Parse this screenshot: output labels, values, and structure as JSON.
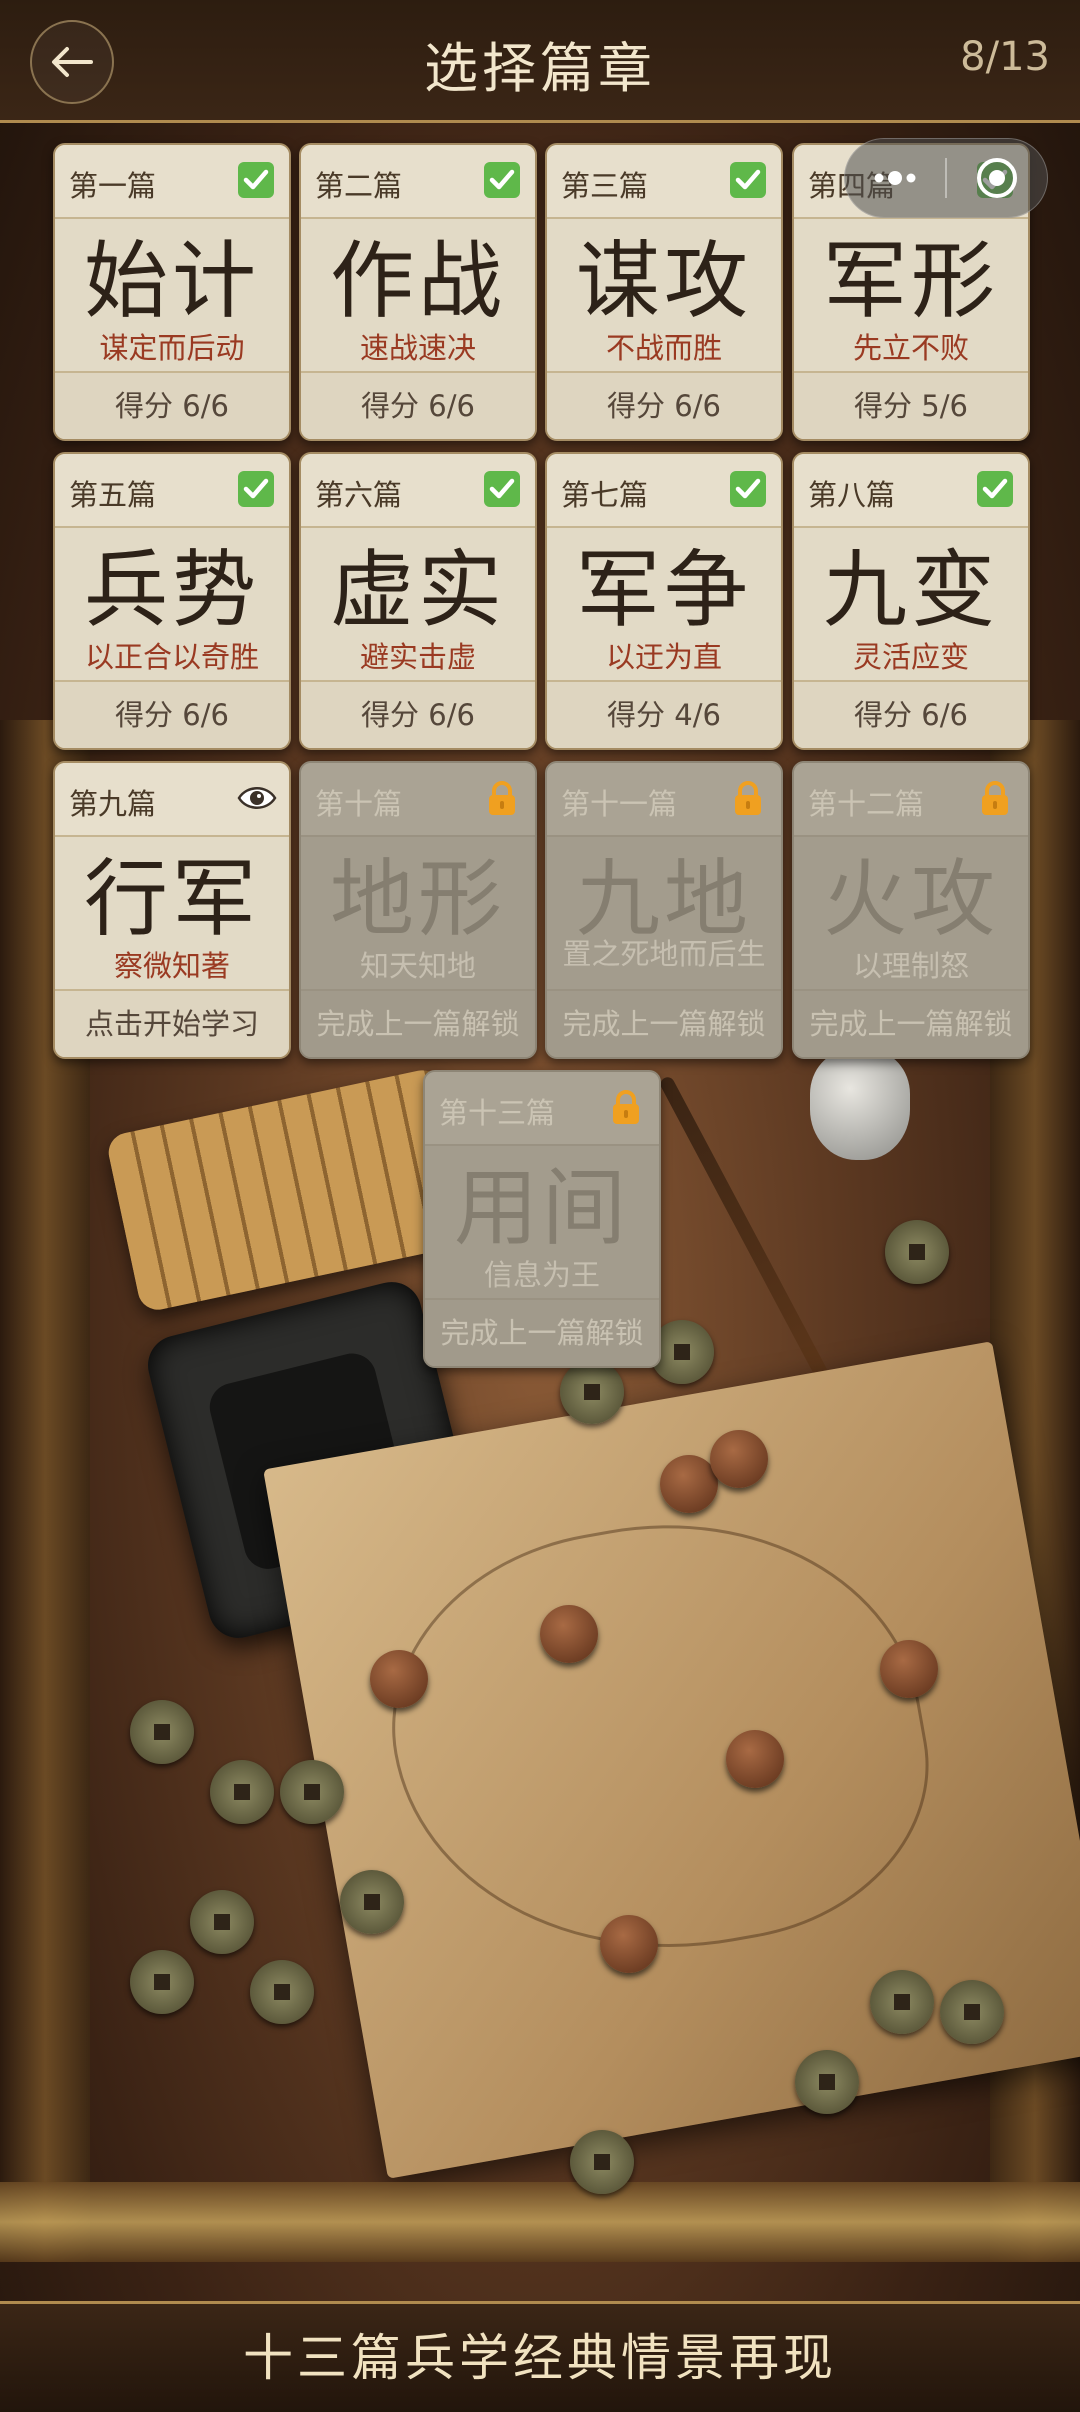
{
  "header": {
    "title": "选择篇章",
    "counter": "8/13",
    "back_icon": "arrow-left-icon"
  },
  "capsule": {
    "more_icon": "more-dots-icon",
    "close_icon": "target-circle-icon"
  },
  "chapters": [
    {
      "num": "第一篇",
      "name": "始计",
      "motto": "谋定而后动",
      "status": "得分 6/6",
      "state": "completed"
    },
    {
      "num": "第二篇",
      "name": "作战",
      "motto": "速战速决",
      "status": "得分 6/6",
      "state": "completed"
    },
    {
      "num": "第三篇",
      "name": "谋攻",
      "motto": "不战而胜",
      "status": "得分 6/6",
      "state": "completed"
    },
    {
      "num": "第四篇",
      "name": "军形",
      "motto": "先立不败",
      "status": "得分 5/6",
      "state": "completed"
    },
    {
      "num": "第五篇",
      "name": "兵势",
      "motto": "以正合以奇胜",
      "status": "得分 6/6",
      "state": "completed"
    },
    {
      "num": "第六篇",
      "name": "虚实",
      "motto": "避实击虚",
      "status": "得分 6/6",
      "state": "completed"
    },
    {
      "num": "第七篇",
      "name": "军争",
      "motto": "以迂为直",
      "status": "得分 4/6",
      "state": "completed"
    },
    {
      "num": "第八篇",
      "name": "九变",
      "motto": "灵活应变",
      "status": "得分 6/6",
      "state": "completed"
    },
    {
      "num": "第九篇",
      "name": "行军",
      "motto": "察微知著",
      "status": "点击开始学习",
      "state": "current"
    },
    {
      "num": "第十篇",
      "name": "地形",
      "motto": "知天知地",
      "status": "完成上一篇解锁",
      "state": "locked"
    },
    {
      "num": "第十一篇",
      "name": "九地",
      "motto": "置之死地而后生",
      "status": "完成上一篇解锁",
      "state": "locked"
    },
    {
      "num": "第十二篇",
      "name": "火攻",
      "motto": "以理制怒",
      "status": "完成上一篇解锁",
      "state": "locked"
    },
    {
      "num": "第十三篇",
      "name": "用间",
      "motto": "信息为王",
      "status": "完成上一篇解锁",
      "state": "locked"
    }
  ],
  "icons": {
    "completed": "checkbox-checked-icon",
    "current": "eye-icon",
    "locked": "lock-icon"
  },
  "colors": {
    "check_green": "#5fb84a",
    "lock_orange": "#f0a020",
    "motto_red": "#9a3a22",
    "header_bg": "#2d1d10",
    "gold_line": "#b08b4f"
  },
  "footer": {
    "text": "十三篇兵学经典情景再现"
  }
}
